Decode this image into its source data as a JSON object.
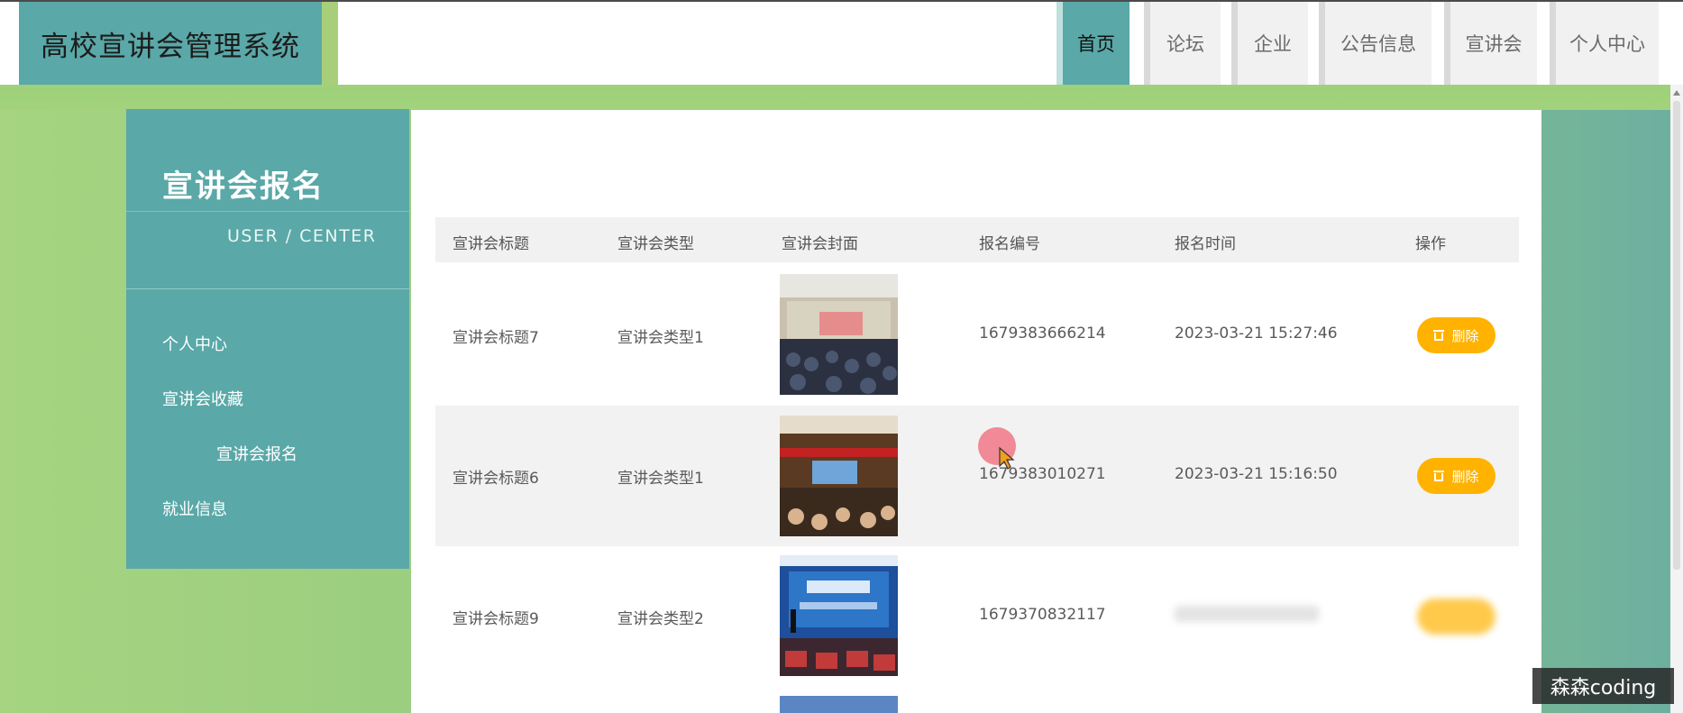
{
  "header": {
    "app_title": "高校宣讲会管理系统",
    "nav": [
      {
        "label": "首页",
        "active": true
      },
      {
        "label": "论坛",
        "active": false
      },
      {
        "label": "企业",
        "active": false
      },
      {
        "label": "公告信息",
        "active": false
      },
      {
        "label": "宣讲会",
        "active": false
      },
      {
        "label": "个人中心",
        "active": false
      }
    ]
  },
  "sidebar": {
    "title": "宣讲会报名",
    "subtitle": "USER / CENTER",
    "items": [
      {
        "label": "个人中心"
      },
      {
        "label": "宣讲会收藏"
      },
      {
        "label": "宣讲会报名"
      },
      {
        "label": "就业信息"
      }
    ]
  },
  "table": {
    "headers": [
      "宣讲会标题",
      "宣讲会类型",
      "宣讲会封面",
      "报名编号",
      "报名时间",
      "操作"
    ],
    "rows": [
      {
        "title": "宣讲会标题7",
        "type": "宣讲会类型1",
        "cover": "lecture-hall-photo",
        "reg_no": "1679383666214",
        "reg_time": "2023-03-21 15:27:46",
        "action": "删除"
      },
      {
        "title": "宣讲会标题6",
        "type": "宣讲会类型1",
        "cover": "auditorium-banner-photo",
        "reg_no": "1679383010271",
        "reg_time": "2023-03-21 15:16:50",
        "action": "删除"
      },
      {
        "title": "宣讲会标题9",
        "type": "宣讲会类型2",
        "cover": "recruitment-stage-photo",
        "reg_no": "1679370832117",
        "reg_time": "",
        "action": ""
      }
    ]
  },
  "watermark": "森森coding",
  "colors": {
    "teal": "#5aa8a8",
    "green": "#a6d480",
    "delete_button": "#ffb300"
  }
}
